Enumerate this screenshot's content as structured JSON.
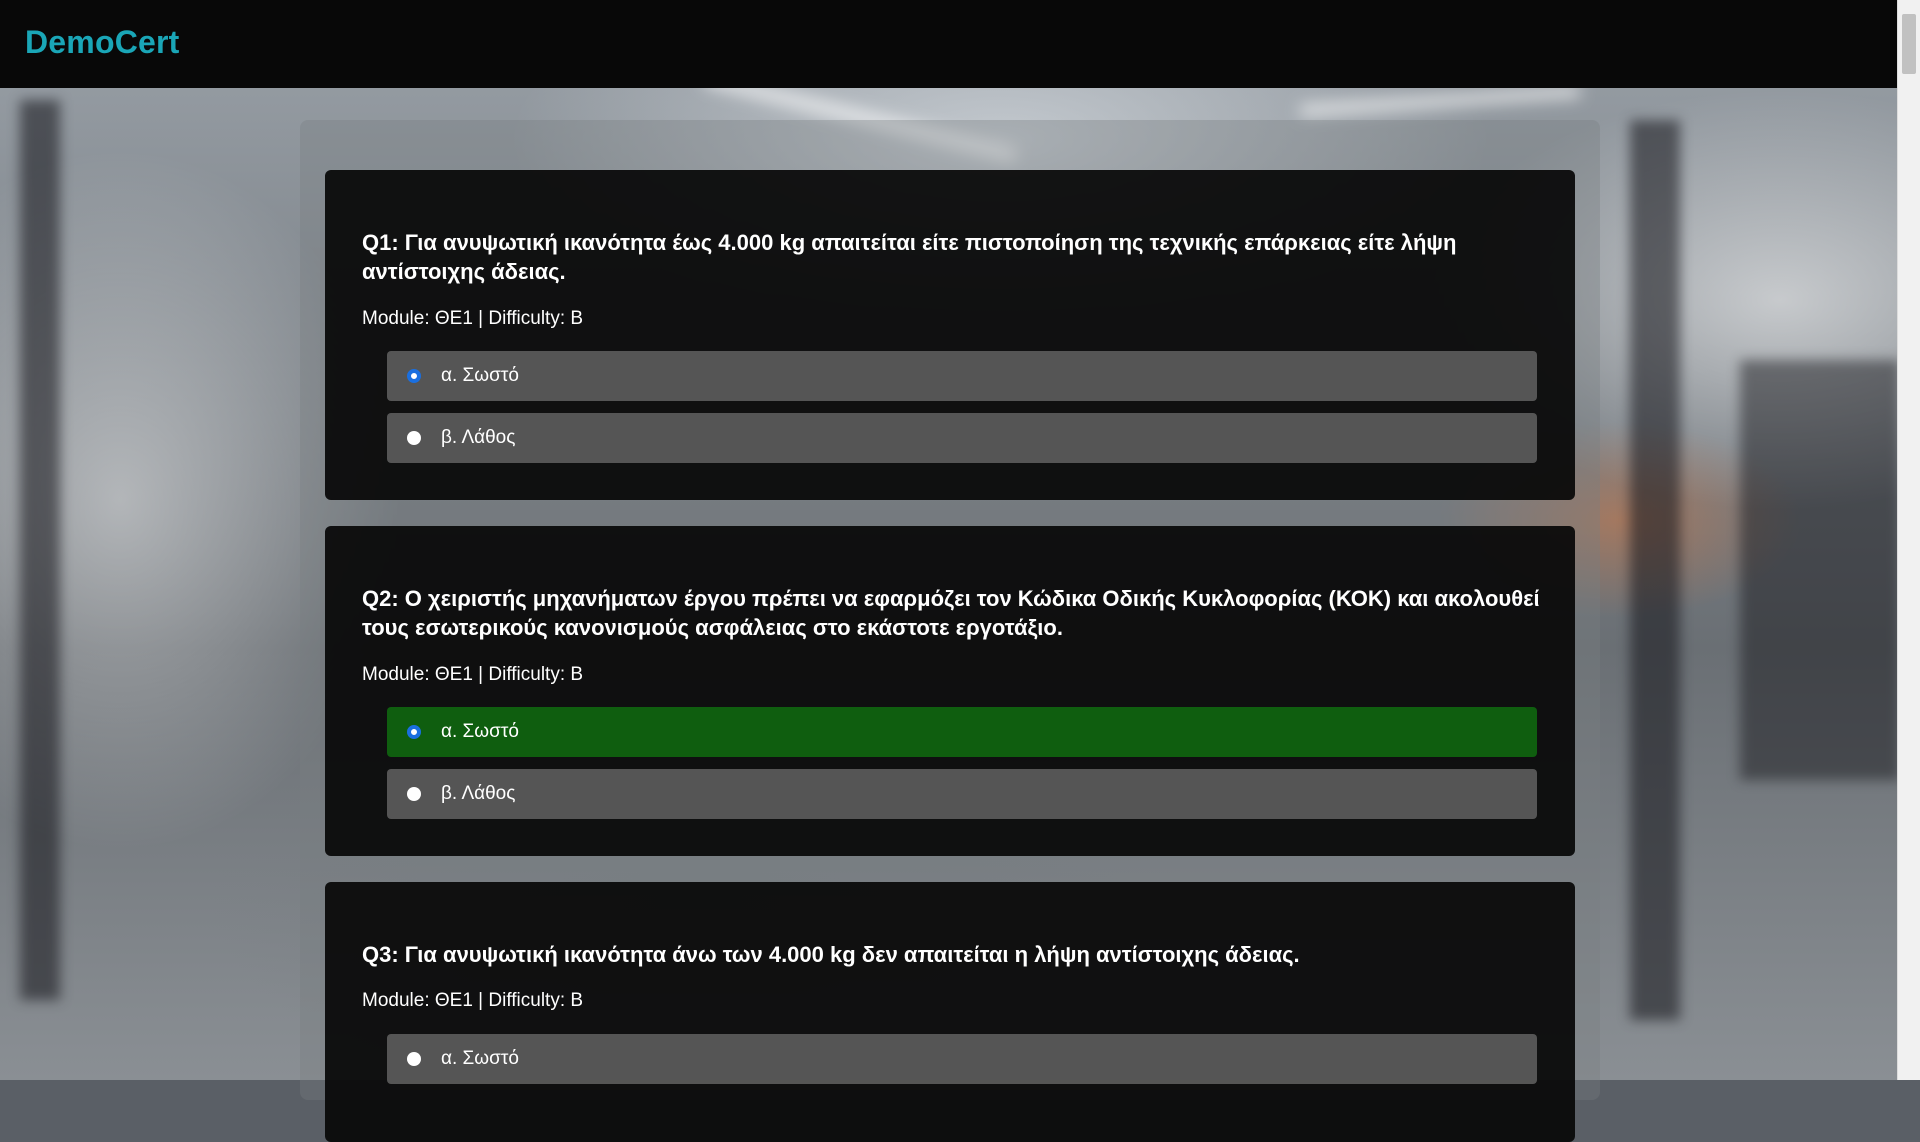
{
  "app": {
    "brand": "DemoCert"
  },
  "questions": [
    {
      "title": "Q1: Για ανυψωτική ικανότητα έως 4.000 kg απαιτείται είτε πιστοποίηση της τεχνικής επάρκειας είτε λήψη αντίστοιχης άδειας.",
      "meta": "Module: ΘΕ1 | Difficulty: B",
      "options": [
        {
          "label": "α. Σωστό",
          "checked": true,
          "highlighted": false
        },
        {
          "label": "β. Λάθος",
          "checked": false,
          "highlighted": false
        }
      ]
    },
    {
      "title": "Q2: Ο χειριστής μηχανήματων έργου πρέπει να εφαρμόζει τον Κώδικα Οδικής Κυκλοφορίας (ΚΟΚ) και ακολουθεί τους εσωτερικούς κανονισμούς ασφάλειας στο εκάστοτε εργοτάξιο.",
      "meta": "Module: ΘΕ1 | Difficulty: B",
      "options": [
        {
          "label": "α. Σωστό",
          "checked": true,
          "highlighted": true
        },
        {
          "label": "β. Λάθος",
          "checked": false,
          "highlighted": false
        }
      ]
    },
    {
      "title": "Q3: Για ανυψωτική ικανότητα άνω των 4.000 kg δεν απαιτείται η λήψη αντίστοιχης άδειας.",
      "meta": "Module: ΘΕ1 | Difficulty: B",
      "options": [
        {
          "label": "α. Σωστό",
          "checked": false,
          "highlighted": false
        }
      ]
    }
  ]
}
